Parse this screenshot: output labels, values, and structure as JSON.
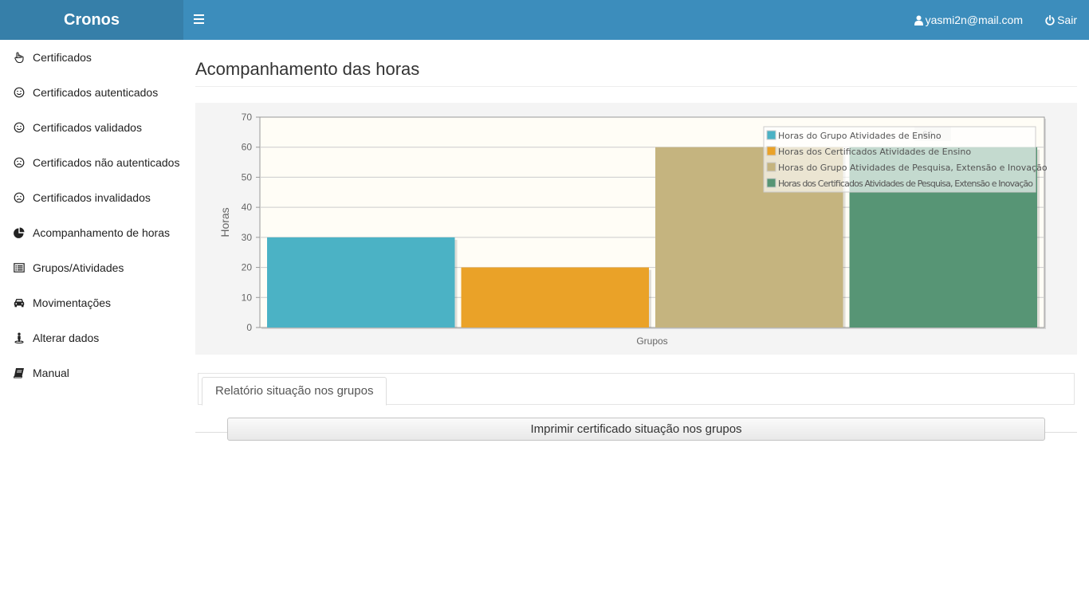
{
  "app": {
    "brand": "Cronos"
  },
  "header": {
    "user_email": "yasmi2n@mail.com",
    "logout_label": "Sair"
  },
  "sidebar": {
    "items": [
      {
        "label": "Certificados",
        "icon": "hand-pointer-icon"
      },
      {
        "label": "Certificados autenticados",
        "icon": "smile-icon"
      },
      {
        "label": "Certificados validados",
        "icon": "smile-icon"
      },
      {
        "label": "Certificados não autenticados",
        "icon": "frown-icon"
      },
      {
        "label": "Certificados invalidados",
        "icon": "frown-icon"
      },
      {
        "label": "Acompanhamento de horas",
        "icon": "pie-chart-icon"
      },
      {
        "label": "Grupos/Atividades",
        "icon": "list-alt-icon"
      },
      {
        "label": "Movimentações",
        "icon": "car-icon"
      },
      {
        "label": "Alterar dados",
        "icon": "street-view-icon"
      },
      {
        "label": "Manual",
        "icon": "book-icon"
      }
    ]
  },
  "main": {
    "title": "Acompanhamento das horas",
    "tab_label": "Relatório situação nos grupos",
    "print_button": "Imprimir certificado situação nos grupos"
  },
  "chart_data": {
    "type": "bar",
    "xlabel": "Grupos",
    "ylabel": "Horas",
    "ylim": [
      0,
      70
    ],
    "yticks": [
      0,
      10,
      20,
      30,
      40,
      50,
      60,
      70
    ],
    "grid": true,
    "legend_position": "top-right",
    "tooltip": ", 60",
    "series": [
      {
        "name": "Horas do Grupo Atividades de Ensino",
        "values": [
          30
        ],
        "color": "#4bb2c5"
      },
      {
        "name": "Horas dos Certificados Atividades de Ensino",
        "values": [
          20
        ],
        "color": "#eaa228"
      },
      {
        "name": "Horas do Grupo Atividades de Pesquisa, Extensão e Inovação",
        "values": [
          60
        ],
        "color": "#c5b47f"
      },
      {
        "name": "Horas dos Certificados Atividades de Pesquisa, Extensão e Inovação",
        "values": [
          60
        ],
        "color": "#579575"
      }
    ]
  }
}
